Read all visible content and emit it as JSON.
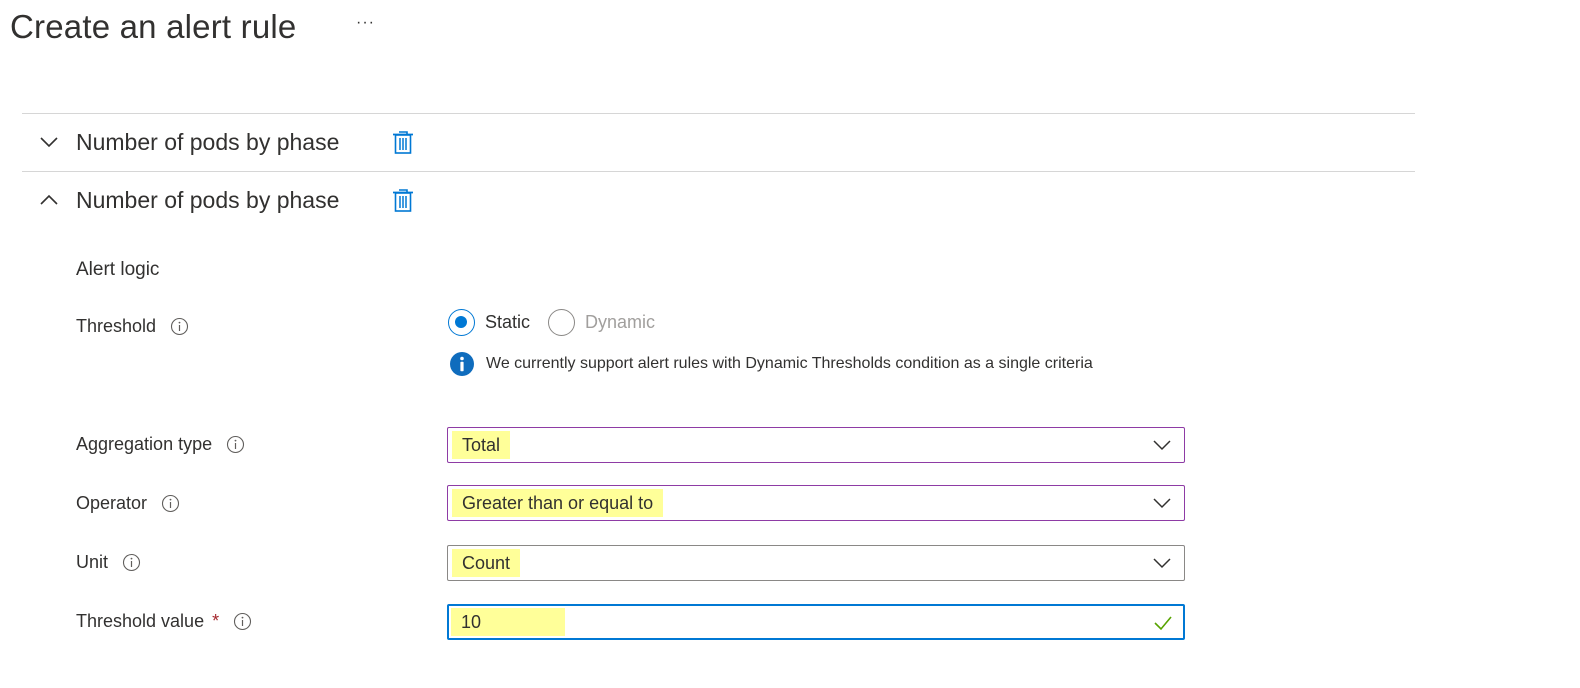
{
  "header": {
    "title": "Create an alert rule",
    "more_label": "···"
  },
  "conditions": [
    {
      "title": "Number of pods by phase",
      "expanded": false,
      "chevron_icon": "chevron-down-icon",
      "delete_icon": "trash-icon"
    },
    {
      "title": "Number of pods by phase",
      "expanded": true,
      "chevron_icon": "chevron-up-icon",
      "delete_icon": "trash-icon"
    }
  ],
  "alert_logic": {
    "section_title": "Alert logic",
    "threshold": {
      "label": "Threshold",
      "options": [
        "Static",
        "Dynamic"
      ],
      "selected": "Static",
      "info_message": "We currently support alert rules with Dynamic Thresholds condition as a single criteria"
    },
    "aggregation_type": {
      "label": "Aggregation type",
      "value": "Total"
    },
    "operator": {
      "label": "Operator",
      "value": "Greater than or equal to"
    },
    "unit": {
      "label": "Unit",
      "value": "Count"
    },
    "threshold_value": {
      "label": "Threshold value",
      "required_mark": "*",
      "value": "10",
      "valid": true
    }
  },
  "colors": {
    "accent": "#0078d4",
    "highlight": "#ffff99",
    "purple_border": "#8e3ba5",
    "required": "#a4262c",
    "valid_check": "#57a300"
  }
}
